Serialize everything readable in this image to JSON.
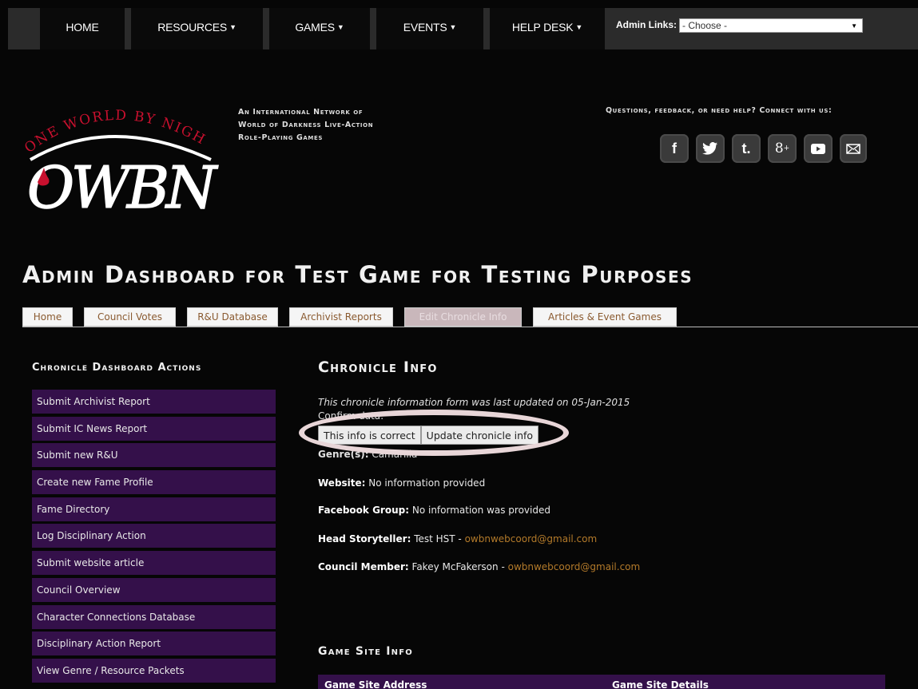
{
  "topnav": {
    "items": [
      {
        "label": "HOME",
        "dropdown": false
      },
      {
        "label": "RESOURCES",
        "dropdown": true
      },
      {
        "label": "GAMES",
        "dropdown": true
      },
      {
        "label": "EVENTS",
        "dropdown": true
      },
      {
        "label": "HELP DESK",
        "dropdown": true
      }
    ],
    "admin_links_label": "Admin Links:",
    "admin_links_value": "- Choose -"
  },
  "header": {
    "logo_arc_text": "ONE WORLD BY NIGHT",
    "logo_text": "OWBN",
    "tagline": [
      "An International Network of",
      "World of Darkness Live-Action",
      "Role-Playing Games"
    ],
    "contact_text": "Questions, feedback, or need help? Connect with us:",
    "social_icons": [
      "facebook-icon",
      "twitter-icon",
      "tumblr-icon",
      "google-plus-icon",
      "youtube-icon",
      "email-icon"
    ]
  },
  "page_title": "Admin Dashboard for Test Game for Testing Purposes",
  "tabs": [
    {
      "label": "Home",
      "active": false
    },
    {
      "label": "Council Votes",
      "active": false
    },
    {
      "label": "R&U Database",
      "active": false
    },
    {
      "label": "Archivist Reports",
      "active": false
    },
    {
      "label": "Edit Chronicle Info",
      "active": true
    },
    {
      "label": "Articles & Event Games",
      "active": false
    }
  ],
  "sidebar": {
    "title": "Chronicle Dashboard Actions",
    "items": [
      "Submit Archivist Report",
      "Submit IC News Report",
      "Submit new R&U",
      "Create new Fame Profile",
      "Fame Directory",
      "Log Disciplinary Action",
      "Submit website article",
      "Council Overview",
      "Character Connections Database",
      "Disciplinary Action Report",
      "View Genre / Resource Packets"
    ]
  },
  "chronicle_info": {
    "title": "Chronicle Info",
    "last_updated": "This chronicle information form was last updated on 05-Jan-2015",
    "confirm_label": "Confirm data:",
    "correct_button": "This info is correct",
    "update_button": "Update chronicle info",
    "genre_label": "Genre(s):",
    "genre_value": "Camarilla",
    "website_label": "Website:",
    "website_value": "No information provided",
    "facebook_label": "Facebook Group:",
    "facebook_value": "No information was provided",
    "hst_label": "Head Storyteller:",
    "hst_value": "Test HST -",
    "hst_email": "owbnwebcoord@gmail.com",
    "council_label": "Council Member:",
    "council_value": "Fakey McFakerson -",
    "council_email": "owbnwebcoord@gmail.com"
  },
  "game_site": {
    "title": "Game Site Info",
    "col_address": "Game Site Address",
    "col_details": "Game Site Details"
  },
  "colors": {
    "background": "#060606",
    "sidebar_item": "#34104a",
    "link": "#b37a2a",
    "highlight_ring": "#e8d6d8"
  }
}
